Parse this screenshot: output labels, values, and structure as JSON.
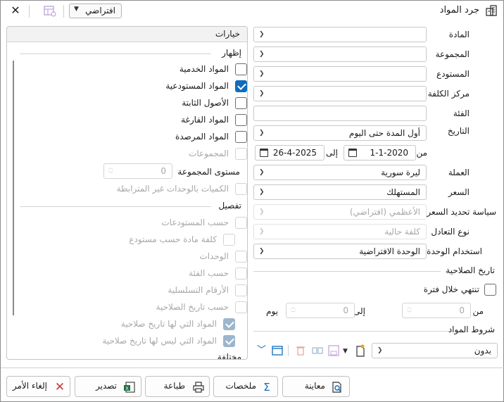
{
  "window": {
    "title": "جرد المواد",
    "preset_value": "افتراضي"
  },
  "fields": {
    "material": {
      "label": "المادة",
      "value": ""
    },
    "group": {
      "label": "المجموعة",
      "value": ""
    },
    "warehouse": {
      "label": "المستودع",
      "value": ""
    },
    "cost_center": {
      "label": "مركز الكلفة",
      "value": ""
    },
    "category": {
      "label": "الفئة",
      "value": ""
    },
    "date": {
      "label": "التاريخ",
      "value": "أول المدة حتى اليوم"
    },
    "from_label": "من",
    "to_label": "إلى",
    "date_from": "1-1-2020",
    "date_to": "26-4-2025",
    "currency": {
      "label": "العملة",
      "value": "ليرة سورية"
    },
    "price": {
      "label": "السعر",
      "value": "المستهلك"
    },
    "price_policy": {
      "label": "سياسة تحديد السعر",
      "value": "الأعظمي (افتراضي)"
    },
    "equivalence": {
      "label": "نوع التعادل",
      "value": "كلفة حالية"
    },
    "unit_usage": {
      "label": "استخدام الوحدة",
      "value": "الوحدة الافتراضية"
    }
  },
  "expiry": {
    "title": "تاريخ الصلاحية",
    "checkbox_label": "تنتهي خلال فترة",
    "from_label": "من",
    "from_value": "0",
    "to_label": "إلى",
    "to_value": "0",
    "unit": "يوم"
  },
  "conditions": {
    "label": "شروط المواد",
    "value": "بدون"
  },
  "options": {
    "header": "خيارات",
    "show_section": "إظهار",
    "show_items": [
      {
        "label": "المواد الخدمية",
        "checked": false
      },
      {
        "label": "المواد المستودعية",
        "checked": true
      },
      {
        "label": "الأصول الثابتة",
        "checked": false
      },
      {
        "label": "المواد الفارغة",
        "checked": false
      },
      {
        "label": "المواد المرصدة",
        "checked": false
      },
      {
        "label": "المجموعات",
        "checked": false
      }
    ],
    "group_level_label": "مستوى المجموعة",
    "group_level_value": "0",
    "unlinked_units_label": "الكميات بالوحدات غير المترابطة",
    "detail_section": "تفصيل",
    "detail_items": [
      {
        "label": "حسب المستودعات"
      },
      {
        "label": "كلفة مادة حسب مستودع"
      },
      {
        "label": "الوحدات"
      },
      {
        "label": "حسب الفئة"
      },
      {
        "label": "الأرقام التسلسلية"
      },
      {
        "label": "حسب تاريخ الصلاحية"
      },
      {
        "label": "المواد التي لها تاريخ صلاحية"
      },
      {
        "label": "المواد التي ليس لها تاريخ صلاحية"
      }
    ],
    "misc_section": "مختلفة"
  },
  "toolbar": {
    "preview": "معاينة",
    "summaries": "ملخصات",
    "print": "طباعة",
    "export": "تصدير",
    "cancel": "إلغاء الأمر"
  },
  "colors": {
    "accent": "#0f6cbd",
    "cancel_x": "#d13438",
    "excel": "#1d6f42"
  }
}
